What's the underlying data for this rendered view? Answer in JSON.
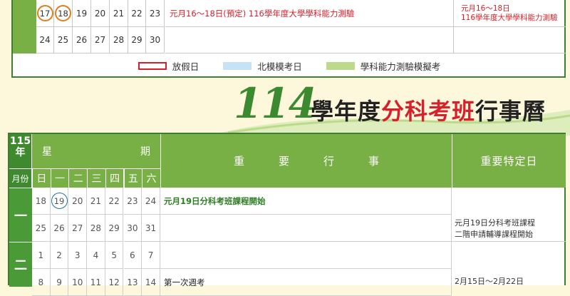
{
  "top_calendar": {
    "week1": [
      {
        "day": "17",
        "circled": true
      },
      {
        "day": "18",
        "circled": true
      },
      {
        "day": "19",
        "circled": false
      },
      {
        "day": "20",
        "circled": false
      },
      {
        "day": "21",
        "circled": false
      },
      {
        "day": "22",
        "circled": false
      },
      {
        "day": "23",
        "circled": false
      }
    ],
    "week2": [
      "24",
      "25",
      "26",
      "27",
      "28",
      "29",
      "30"
    ],
    "event1": "元月16～18日(預定) 116學年度大學學科能力測驗",
    "special1_line1": "元月16～18日",
    "special1_line2": "116學年度大學學科能力測驗",
    "legend": {
      "holiday": "放假日",
      "mock_exam": "北模模考日",
      "gsat_mock": "學科能力測驗模擬考"
    }
  },
  "title": {
    "number": "114",
    "part1": "學年度",
    "part2": "分科考班",
    "part3": "行事曆"
  },
  "main_calendar": {
    "header": {
      "year_num": "115",
      "year_char": "年",
      "month_label": "月份",
      "week_left": "星",
      "week_right": "期",
      "days": [
        "日",
        "一",
        "二",
        "三",
        "四",
        "五",
        "六"
      ],
      "events_title": [
        "重",
        "要",
        "行",
        "事"
      ],
      "special_title": "重要特定日"
    },
    "months": [
      "一",
      "二"
    ],
    "weeks": [
      {
        "days": [
          "18",
          "19",
          "20",
          "21",
          "22",
          "23",
          "24"
        ],
        "circled_index": 1,
        "event": "元月19日分科考班課程開始",
        "event_bold": true
      },
      {
        "days": [
          "25",
          "26",
          "27",
          "28",
          "29",
          "30",
          "31"
        ],
        "event": ""
      },
      {
        "days": [
          "1",
          "2",
          "3",
          "4",
          "5",
          "6",
          "7"
        ],
        "event": ""
      },
      {
        "days": [
          "8",
          "9",
          "10",
          "11",
          "12",
          "13",
          "14"
        ],
        "event": "第一次週考"
      }
    ],
    "special_notes": {
      "note1_line1": "元月19日分科考班課程",
      "note1_line2": "二階申請輔導課程開始",
      "note2": "2月15日～2月22日"
    }
  },
  "colors": {
    "green_dark": "#3f7d32",
    "green_header": "#79b045",
    "red": "#d6202a",
    "orange_circle": "#e07c1c",
    "blue_circle": "#1f6fa8",
    "background": "#fdf8dc"
  }
}
